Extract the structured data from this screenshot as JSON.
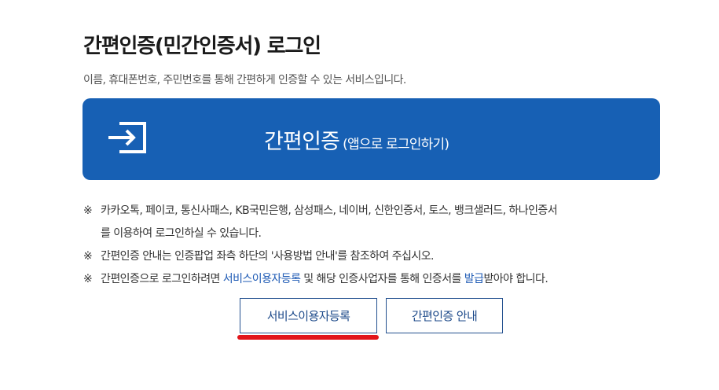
{
  "header": {
    "title": "간편인증(민간인증서) 로그인",
    "description": "이름, 휴대폰번호, 주민번호를 통해 간편하게 인증할 수 있는 서비스입니다."
  },
  "login_button": {
    "main_label": "간편인증",
    "sub_label": "(앱으로 로그인하기)",
    "icon": "sign-in-icon"
  },
  "notes": {
    "mark": "※",
    "note1_line1": "카카오톡, 페이코, 통신사패스, KB국민은행, 삼성패스, 네이버, 신한인증서, 토스, 뱅크샐러드, 하나인증서",
    "note1_line2": "를 이용하여 로그인하실 수 있습니다.",
    "note2": "간편인증 안내는 인증팝업 좌측 하단의 '사용방법 안내'를 참조하여 주십시오.",
    "note3_prefix": "간편인증으로 로그인하려면 ",
    "note3_link1": "서비스이용자등록",
    "note3_middle": " 및 해당 인증사업자를 통해 인증서를 ",
    "note3_link2": "발급",
    "note3_suffix": "받아야 합니다."
  },
  "buttons": {
    "register_label": "서비스이용자등록",
    "guide_label": "간편인증 안내"
  },
  "colors": {
    "primary": "#1760b4",
    "link": "#1f5bb5",
    "outline": "#23508f",
    "highlight": "#e2161b"
  }
}
